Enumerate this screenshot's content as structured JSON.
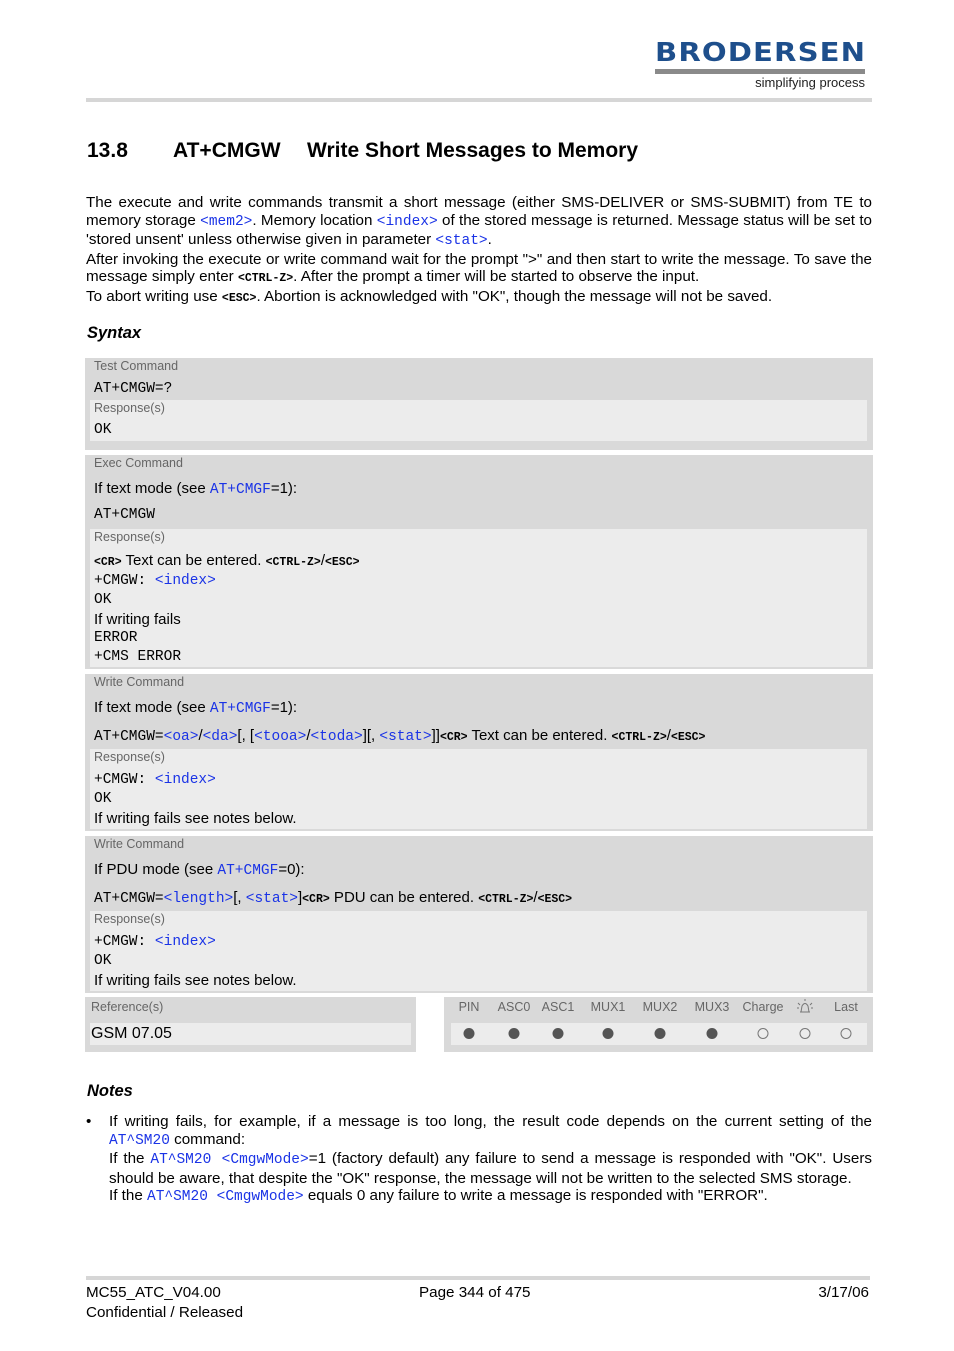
{
  "header": {
    "logo_word": "BRODERSEN",
    "logo_tagline": "simplifying process",
    "brand_color": "#1e4f8c"
  },
  "section": {
    "number": "13.8",
    "command": "AT+CMGW",
    "title": "Write Short Messages to Memory"
  },
  "intro": {
    "p1_a": "The execute and write commands transmit a short message (either SMS-DELIVER or SMS-SUBMIT) from TE to memory storage ",
    "p1_mem2": "<mem2>",
    "p1_b": ". Memory location ",
    "p1_index": "<index>",
    "p1_c": " of the stored message is returned. Message status will be set to 'stored unsent' unless otherwise given in parameter ",
    "p1_stat": "<stat>",
    "p1_d": ".",
    "p2_a": "After invoking the execute or write command wait for the prompt \">\" and then start to write the message. To save the message simply enter ",
    "p2_ctrlz": "<CTRL-Z>",
    "p2_b": ". After the prompt a timer will be started to observe the input.",
    "p3_a": "To abort writing use ",
    "p3_esc": "<ESC>",
    "p3_b": ". Abortion is acknowledged with \"OK\", though the message will not be saved."
  },
  "syntax_heading": "Syntax",
  "blocks": {
    "test": {
      "label": "Test Command",
      "command": "AT+CMGW=?",
      "response_label": "Response(s)",
      "response": "OK"
    },
    "exec": {
      "label": "Exec Command",
      "mode_a": "If text mode (see ",
      "mode_link": "AT+CMGF",
      "mode_b": "=1):",
      "command": "AT+CMGW",
      "response_label": "Response(s)",
      "r1_cr": "<CR>",
      "r1_text": " Text can be entered. ",
      "r1_ctrlz": "<CTRL-Z>",
      "r1_sep": "/",
      "r1_esc": "<ESC>",
      "r2_prefix": "+CMGW: ",
      "r2_index": "<index>",
      "r3": "OK",
      "r4": "If writing fails",
      "r5": "ERROR",
      "r6": "+CMS ERROR"
    },
    "write_text": {
      "label": "Write Command",
      "mode_a": "If text mode (see ",
      "mode_link": "AT+CMGF",
      "mode_b": "=1):",
      "cmd_prefix": "AT+CMGW=",
      "p_oa": "<oa>",
      "slash1": "/",
      "p_da": "<da>",
      "br1": "[, [",
      "p_tooa": "<tooa>",
      "slash2": "/",
      "p_toda": "<toda>",
      "br2": "][, ",
      "p_stat": "<stat>",
      "br3": "]]",
      "cr": "<CR>",
      "text": " Text can be entered. ",
      "ctrlz": "<CTRL-Z>",
      "sep": "/",
      "esc": "<ESC>",
      "response_label": "Response(s)",
      "r1_prefix": "+CMGW: ",
      "r1_index": "<index>",
      "r2": "OK",
      "r3": "If writing fails see notes below."
    },
    "write_pdu": {
      "label": "Write Command",
      "mode_a": "If PDU mode (see ",
      "mode_link": "AT+CMGF",
      "mode_b": "=0):",
      "cmd_prefix": "AT+CMGW=",
      "p_length": "<length>",
      "br1": "[, ",
      "p_stat": "<stat>",
      "br2": "]",
      "cr": "<CR>",
      "text": " PDU can be entered. ",
      "ctrlz": "<CTRL-Z>",
      "sep": "/",
      "esc": "<ESC>",
      "response_label": "Response(s)",
      "r1_prefix": "+CMGW: ",
      "r1_index": "<index>",
      "r2": "OK",
      "r3": "If writing fails see notes below."
    }
  },
  "reference": {
    "label": "Reference(s)",
    "value": "GSM 07.05"
  },
  "availability": [
    {
      "label": "PIN",
      "supported": true
    },
    {
      "label": "ASC0",
      "supported": true
    },
    {
      "label": "ASC1",
      "supported": true
    },
    {
      "label": "MUX1",
      "supported": true
    },
    {
      "label": "MUX2",
      "supported": true
    },
    {
      "label": "MUX3",
      "supported": true
    },
    {
      "label": "Charge",
      "supported": false
    },
    {
      "label": "alarm-icon",
      "supported": false
    },
    {
      "label": "Last",
      "supported": false
    }
  ],
  "notes": {
    "heading": "Notes",
    "bullet": "•",
    "a": "If writing fails, for example, if a message is too long, the result code depends on the current setting of the ",
    "sm20_1": "AT^SM20",
    "b": " command:",
    "c": "If the ",
    "sm20_2": "AT^SM20",
    "mode_1": " <CmgwMode>",
    "d": "=1 (factory default) any failure to send a message is responded with \"OK\". Users should be aware, that despite the \"OK\" response, the message will not be written to the selected SMS storage.",
    "e": "If the ",
    "sm20_3": "AT^SM20",
    "mode_2": " <CmgwMode>",
    "f": " equals 0 any failure to write a message is responded with \"ERROR\"."
  },
  "footer": {
    "doc_id": "MC55_ATC_V04.00",
    "status": "Confidential / Released",
    "page": "Page 344 of 475",
    "date": "3/17/06"
  }
}
